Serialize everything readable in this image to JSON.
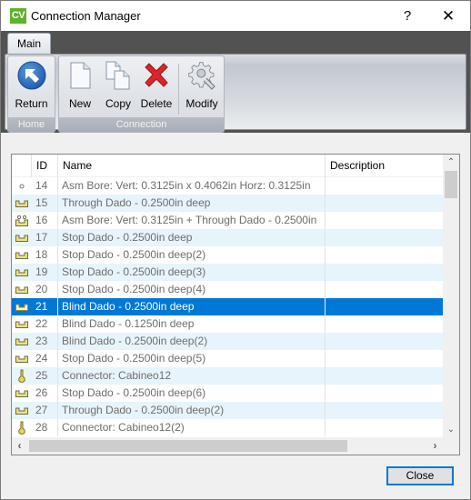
{
  "window": {
    "app_icon_text": "CV",
    "title": "Connection Manager",
    "help_label": "?",
    "close_label": "✕"
  },
  "ribbon": {
    "tabs": [
      {
        "label": "Main",
        "active": true
      }
    ],
    "groups": {
      "home": {
        "label": "Home",
        "buttons": [
          {
            "label": "Return",
            "icon": "return-arrow-icon"
          }
        ]
      },
      "connection": {
        "label": "Connection",
        "buttons": [
          {
            "label": "New",
            "icon": "new-document-icon"
          },
          {
            "label": "Copy",
            "icon": "copy-documents-icon"
          },
          {
            "label": "Delete",
            "icon": "delete-x-icon"
          },
          {
            "label": "Modify",
            "icon": "gear-wrench-icon"
          }
        ]
      }
    }
  },
  "grid": {
    "columns": [
      "",
      "ID",
      "Name",
      "Description"
    ],
    "selected_id": "21",
    "rows": [
      {
        "icon": "bore",
        "id": "14",
        "name": "Asm Bore: Vert: 0.3125in x 0.4062in Horz: 0.3125in",
        "description": ""
      },
      {
        "icon": "dado",
        "id": "15",
        "name": "Through Dado - 0.2500in deep",
        "description": ""
      },
      {
        "icon": "bore-dado",
        "id": "16",
        "name": "Asm Bore: Vert: 0.3125in + Through Dado - 0.2500in",
        "description": ""
      },
      {
        "icon": "dado",
        "id": "17",
        "name": "Stop Dado - 0.2500in deep",
        "description": ""
      },
      {
        "icon": "dado",
        "id": "18",
        "name": "Stop Dado - 0.2500in deep(2)",
        "description": ""
      },
      {
        "icon": "dado",
        "id": "19",
        "name": "Stop Dado - 0.2500in deep(3)",
        "description": ""
      },
      {
        "icon": "dado",
        "id": "20",
        "name": "Stop Dado - 0.2500in deep(4)",
        "description": ""
      },
      {
        "icon": "dado",
        "id": "21",
        "name": "Blind Dado - 0.2500in deep",
        "description": ""
      },
      {
        "icon": "dado",
        "id": "22",
        "name": "Blind Dado - 0.1250in deep",
        "description": ""
      },
      {
        "icon": "dado",
        "id": "23",
        "name": "Blind Dado - 0.2500in deep(2)",
        "description": ""
      },
      {
        "icon": "dado",
        "id": "24",
        "name": "Stop Dado - 0.2500in deep(5)",
        "description": ""
      },
      {
        "icon": "connector",
        "id": "25",
        "name": "Connector: Cabineo12",
        "description": ""
      },
      {
        "icon": "dado",
        "id": "26",
        "name": "Stop Dado - 0.2500in deep(6)",
        "description": ""
      },
      {
        "icon": "dado",
        "id": "27",
        "name": "Through Dado - 0.2500in deep(2)",
        "description": ""
      },
      {
        "icon": "connector",
        "id": "28",
        "name": "Connector: Cabineo12(2)",
        "description": ""
      }
    ]
  },
  "footer": {
    "close_button": "Close"
  },
  "colors": {
    "selection": "#0078d7",
    "alt_row": "#e7f4fb",
    "app_icon": "#5fb32a",
    "delete_red": "#d9262b",
    "return_blue": "#2467b8"
  }
}
